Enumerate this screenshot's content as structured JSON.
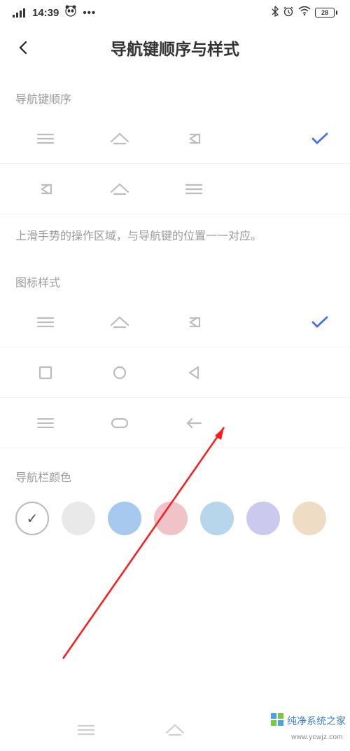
{
  "status": {
    "time": "14:39",
    "battery": "28"
  },
  "header": {
    "title": "导航键顺序与样式"
  },
  "sections": {
    "order_label": "导航键顺序",
    "order_hint": "上滑手势的操作区域，与导航键的位置一一对应。",
    "style_label": "图标样式",
    "color_label": "导航栏颜色"
  },
  "colors": {
    "swatches": [
      "#ffffff",
      "#e9e9e9",
      "#a8c9ef",
      "#efc3c8",
      "#b7d6ec",
      "#cbc9ee",
      "#eedcc4"
    ]
  },
  "watermark": {
    "text": "纯净系统之家",
    "url": "www.ycwjz.com"
  }
}
